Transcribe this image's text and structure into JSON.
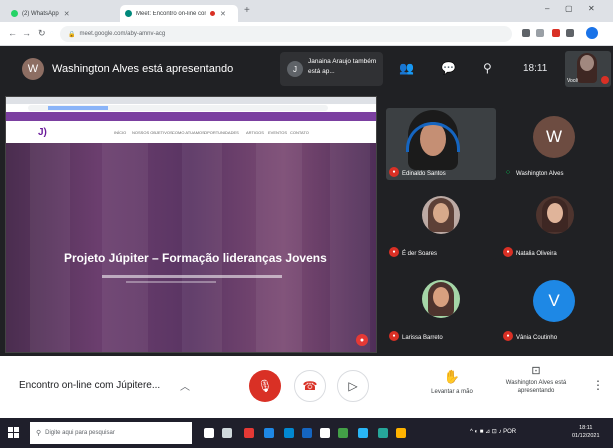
{
  "browser": {
    "tabs": [
      {
        "label": "(2) WhatsApp",
        "fav_color": "#25d366",
        "active": false
      },
      {
        "label": "Meet: Encontro on-line com",
        "fav_color": "#00897b",
        "active": true
      }
    ],
    "url": "meet.google.com/aby-amnv-acg",
    "window_controls": [
      "–",
      "▢",
      "✕"
    ]
  },
  "meet": {
    "presenter": {
      "initial": "W",
      "text": "Washington Alves está apresentando"
    },
    "also_presenting": {
      "initial": "J",
      "text": "Janaina Araujo também está ap..."
    },
    "clock": "18:11",
    "self_view_label": "Você",
    "shared_screen": {
      "title": "Projeto Júpiter – Formação lideranças Jovens",
      "nav": [
        "INÍCIO",
        "NOSSOS OBJETIVOS",
        "COMO ATUAMOS",
        "OPORTUNIDADES",
        "ARTIGOS",
        "EVENTOS",
        "CONTATO"
      ]
    },
    "participants": [
      {
        "name": "Edinaldo Santos",
        "muted": true,
        "kind": "video"
      },
      {
        "name": "Washington Alves",
        "muted": false,
        "kind": "letter",
        "initial": "W",
        "color": "#6d4c41"
      },
      {
        "name": "É der Soares",
        "muted": true,
        "kind": "photo"
      },
      {
        "name": "Natalia Oliveira",
        "muted": true,
        "kind": "photo"
      },
      {
        "name": "Larissa Barreto",
        "muted": true,
        "kind": "photo"
      },
      {
        "name": "Vânia Coutinho",
        "muted": true,
        "kind": "letter",
        "initial": "V",
        "color": "#1e88e5"
      }
    ]
  },
  "bottombar": {
    "meeting_title": "Encontro on-line com Júpitere...",
    "raise_hand_label": "Levantar a mão",
    "presenting_label": "Washington Alves está apresentando"
  },
  "taskbar": {
    "search_placeholder": "Digite aqui para pesquisar",
    "tray_text": "^ ◐ ■ ⊿ ⊡ ♪ POR",
    "time": "18:11",
    "date": "01/12/2021"
  }
}
